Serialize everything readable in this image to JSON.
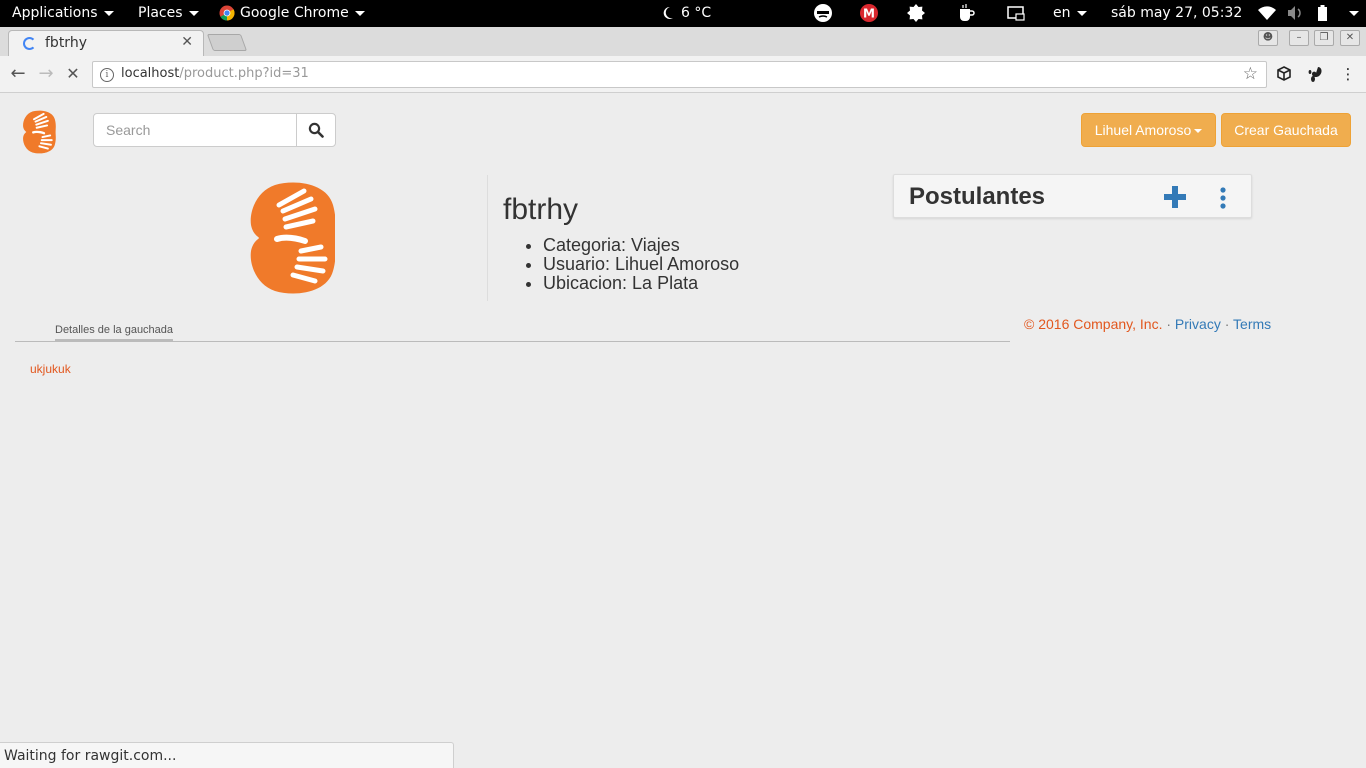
{
  "topbar": {
    "applications": "Applications",
    "places": "Places",
    "app": "Google Chrome",
    "weather": "6 °C",
    "language": "en",
    "datetime": "sáb may 27, 05:32"
  },
  "browser": {
    "tab_title": "fbtrhy",
    "url_host": "localhost",
    "url_path": "/product.php?id=31",
    "status": "Waiting for rawgit.com..."
  },
  "header": {
    "search_placeholder": "Search",
    "user_button": "Lihuel Amoroso",
    "create_button": "Crear Gauchada"
  },
  "product": {
    "title": "fbtrhy",
    "details": [
      "Categoria: Viajes",
      "Usuario: Lihuel Amoroso",
      "Ubicacion: La Plata"
    ]
  },
  "applicants_panel": {
    "title": "Postulantes"
  },
  "tabs": {
    "details_label": "Detalles de la gauchada",
    "details_text": "ukjukuk"
  },
  "footer": {
    "copyright": "© 2016 Company, Inc.",
    "sep": "·",
    "privacy": "Privacy",
    "terms": "Terms"
  },
  "colors": {
    "brand_orange": "#f07a2a",
    "warning": "#f0ad4e",
    "link": "#337ab7",
    "accent_text": "#e2571e"
  }
}
